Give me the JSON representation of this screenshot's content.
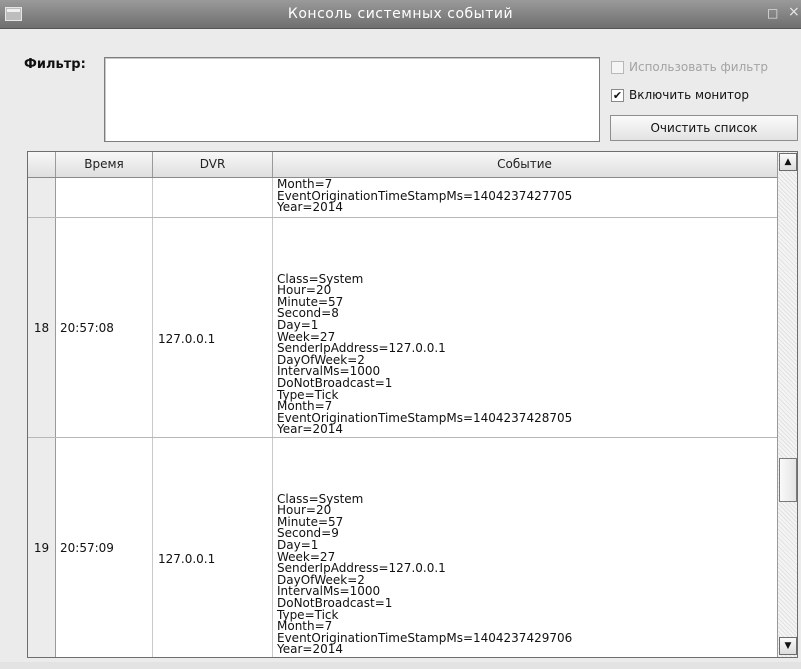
{
  "window": {
    "title": "Консоль системных событий",
    "maximize_icon": "□",
    "close_icon": "×"
  },
  "filter": {
    "label": "Фильтр:",
    "value": "",
    "use_filter_label": "Использовать фильтр",
    "use_filter_checked": false,
    "enable_monitor_label": "Включить монитор",
    "enable_monitor_checked": true,
    "enable_monitor_mark": "✔",
    "clear_button_label": "Очистить список"
  },
  "table": {
    "columns": [
      "",
      "Время",
      "DVR",
      "Событие"
    ],
    "rows": [
      {
        "num": "",
        "time": "",
        "dvr": "",
        "event": [
          "Month=7",
          "EventOriginationTimeStampMs=1404237427705",
          "Year=2014"
        ]
      },
      {
        "num": "18",
        "time": "20:57:08",
        "dvr": "127.0.0.1",
        "event": [
          "Class=System",
          "Hour=20",
          "Minute=57",
          "Second=8",
          "Day=1",
          "Week=27",
          "SenderIpAddress=127.0.0.1",
          "DayOfWeek=2",
          "IntervalMs=1000",
          "DoNotBroadcast=1",
          "Type=Tick",
          "Month=7",
          "EventOriginationTimeStampMs=1404237428705",
          "Year=2014"
        ]
      },
      {
        "num": "19",
        "time": "20:57:09",
        "dvr": "127.0.0.1",
        "event": [
          "Class=System",
          "Hour=20",
          "Minute=57",
          "Second=9",
          "Day=1",
          "Week=27",
          "SenderIpAddress=127.0.0.1",
          "DayOfWeek=2",
          "IntervalMs=1000",
          "DoNotBroadcast=1",
          "Type=Tick",
          "Month=7",
          "EventOriginationTimeStampMs=1404237429706",
          "Year=2014"
        ]
      }
    ]
  },
  "scrollbar": {
    "up_icon": "▲",
    "down_icon": "▼"
  }
}
